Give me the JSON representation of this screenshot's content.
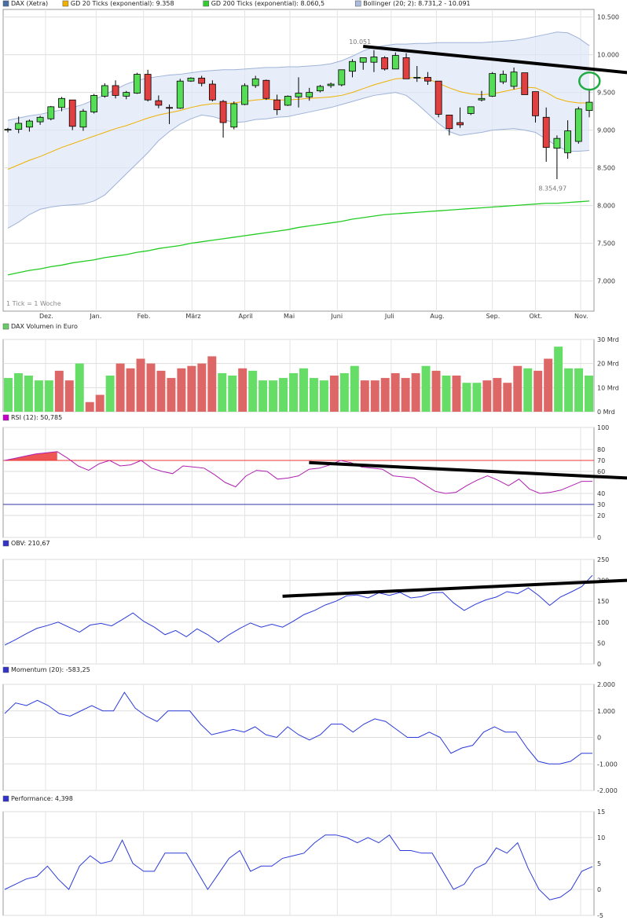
{
  "chart_data": [
    {
      "type": "candlestick",
      "legend": [
        {
          "label": "DAX (Xetra)",
          "color": "#4a6fa5"
        },
        {
          "label": "GD 20 Ticks (exponential): 9.358",
          "color": "#f0b000"
        },
        {
          "label": "GD 200 Ticks (exponential): 8.060,5",
          "color": "#33cc33"
        },
        {
          "label": "Bollinger (20; 2): 8.731,2 - 10.091",
          "color": "#aabbdd"
        }
      ],
      "ylim": [
        6600,
        10600
      ],
      "yticks": [
        {
          "v": 10500,
          "label": "10.500"
        },
        {
          "v": 10000,
          "label": "10.000"
        },
        {
          "v": 9500,
          "label": "9.500"
        },
        {
          "v": 9000,
          "label": "9.000"
        },
        {
          "v": 8500,
          "label": "8.500"
        },
        {
          "v": 8000,
          "label": "8.000"
        },
        {
          "v": 7500,
          "label": "7.500"
        },
        {
          "v": 7000,
          "label": "7.000"
        }
      ],
      "month_labels": [
        {
          "i": 3.5,
          "label": "Dez."
        },
        {
          "i": 8.2,
          "label": "Jan."
        },
        {
          "i": 12.6,
          "label": "Feb."
        },
        {
          "i": 17.1,
          "label": "März"
        },
        {
          "i": 22.0,
          "label": "April"
        },
        {
          "i": 26.2,
          "label": "Mai"
        },
        {
          "i": 30.6,
          "label": "Juni"
        },
        {
          "i": 35.6,
          "label": "Juli"
        },
        {
          "i": 39.8,
          "label": "Aug."
        },
        {
          "i": 45.0,
          "label": "Sep."
        },
        {
          "i": 49.0,
          "label": "Okt."
        },
        {
          "i": 53.2,
          "label": "Nov."
        }
      ],
      "tick_note": "1 Tick = 1 Woche",
      "annotations": [
        {
          "label": "10.051",
          "i": 33,
          "v": 10140
        },
        {
          "label": "8.354,97",
          "i": 50.6,
          "v": 8200
        }
      ],
      "candles": [
        [
          9000,
          9030,
          8970,
          9010
        ],
        [
          9010,
          9180,
          8960,
          9090
        ],
        [
          9040,
          9140,
          8980,
          9120
        ],
        [
          9110,
          9190,
          9070,
          9170
        ],
        [
          9150,
          9320,
          9130,
          9310
        ],
        [
          9300,
          9440,
          9250,
          9420
        ],
        [
          9400,
          9300,
          9000,
          9050
        ],
        [
          9040,
          9280,
          8990,
          9250
        ],
        [
          9240,
          9480,
          9220,
          9460
        ],
        [
          9450,
          9620,
          9430,
          9590
        ],
        [
          9590,
          9660,
          9420,
          9460
        ],
        [
          9450,
          9520,
          9410,
          9500
        ],
        [
          9490,
          9760,
          9480,
          9740
        ],
        [
          9740,
          9800,
          9380,
          9400
        ],
        [
          9390,
          9460,
          9290,
          9330
        ],
        [
          9300,
          9340,
          9080,
          9290
        ],
        [
          9290,
          9680,
          9280,
          9650
        ],
        [
          9650,
          9700,
          9640,
          9690
        ],
        [
          9690,
          9720,
          9580,
          9620
        ],
        [
          9610,
          9660,
          9380,
          9400
        ],
        [
          9380,
          9400,
          8900,
          9100
        ],
        [
          9040,
          9380,
          9010,
          9350
        ],
        [
          9340,
          9620,
          9330,
          9590
        ],
        [
          9590,
          9720,
          9560,
          9680
        ],
        [
          9660,
          9670,
          9400,
          9420
        ],
        [
          9400,
          9470,
          9200,
          9270
        ],
        [
          9330,
          9460,
          9320,
          9450
        ],
        [
          9440,
          9700,
          9300,
          9490
        ],
        [
          9440,
          9560,
          9390,
          9500
        ],
        [
          9520,
          9600,
          9500,
          9580
        ],
        [
          9590,
          9630,
          9560,
          9610
        ],
        [
          9600,
          9800,
          9580,
          9800
        ],
        [
          9780,
          9940,
          9700,
          9910
        ],
        [
          9900,
          9950,
          9800,
          9960
        ],
        [
          9900,
          10060,
          9770,
          9970
        ],
        [
          9960,
          9980,
          9790,
          9810
        ],
        [
          9810,
          10030,
          9810,
          9990
        ],
        [
          9960,
          10020,
          9680,
          9680
        ],
        [
          9700,
          9850,
          9640,
          9700
        ],
        [
          9700,
          9770,
          9600,
          9650
        ],
        [
          9650,
          9640,
          9170,
          9210
        ],
        [
          9200,
          9170,
          8930,
          9020
        ],
        [
          9100,
          9300,
          9030,
          9070
        ],
        [
          9220,
          9310,
          9200,
          9310
        ],
        [
          9400,
          9520,
          9380,
          9420
        ],
        [
          9450,
          9770,
          9440,
          9750
        ],
        [
          9640,
          9790,
          9610,
          9740
        ],
        [
          9580,
          9830,
          9540,
          9770
        ],
        [
          9760,
          9750,
          9490,
          9470
        ],
        [
          9510,
          9480,
          9100,
          9190
        ],
        [
          9170,
          9300,
          8580,
          8770
        ],
        [
          8760,
          8930,
          8350,
          8890
        ],
        [
          8700,
          9130,
          8620,
          8990
        ],
        [
          8850,
          9310,
          8820,
          9280
        ],
        [
          9260,
          9550,
          9170,
          9370
        ]
      ],
      "bollinger_upper": [
        9130,
        9160,
        9190,
        9210,
        9240,
        9270,
        9300,
        9340,
        9400,
        9470,
        9540,
        9610,
        9660,
        9690,
        9710,
        9730,
        9740,
        9760,
        9780,
        9790,
        9800,
        9800,
        9810,
        9820,
        9830,
        9830,
        9840,
        9840,
        9850,
        9860,
        9880,
        9920,
        9980,
        10050,
        10100,
        10120,
        10140,
        10140,
        10150,
        10150,
        10160,
        10160,
        10160,
        10160,
        10160,
        10170,
        10180,
        10190,
        10210,
        10240,
        10270,
        10300,
        10290,
        10220,
        10120
      ],
      "bollinger_lower": [
        7700,
        7780,
        7880,
        7950,
        7980,
        8000,
        8010,
        8020,
        8060,
        8140,
        8280,
        8420,
        8560,
        8700,
        8860,
        8980,
        9080,
        9150,
        9200,
        9180,
        9140,
        9100,
        9110,
        9140,
        9150,
        9170,
        9180,
        9210,
        9240,
        9270,
        9300,
        9340,
        9380,
        9420,
        9460,
        9480,
        9500,
        9460,
        9350,
        9220,
        9090,
        8980,
        8930,
        8950,
        8970,
        9000,
        9010,
        9020,
        9000,
        8970,
        8880,
        8790,
        8720,
        8720,
        8730
      ],
      "gd20": [
        8480,
        8540,
        8600,
        8650,
        8710,
        8770,
        8820,
        8870,
        8920,
        8970,
        9020,
        9060,
        9110,
        9160,
        9200,
        9230,
        9260,
        9300,
        9330,
        9350,
        9350,
        9360,
        9380,
        9400,
        9410,
        9400,
        9400,
        9410,
        9420,
        9430,
        9440,
        9460,
        9500,
        9550,
        9600,
        9640,
        9680,
        9690,
        9700,
        9680,
        9620,
        9560,
        9510,
        9480,
        9470,
        9480,
        9510,
        9540,
        9570,
        9560,
        9500,
        9420,
        9380,
        9360,
        9360
      ],
      "gd200": [
        7080,
        7110,
        7140,
        7160,
        7190,
        7210,
        7240,
        7260,
        7280,
        7310,
        7330,
        7350,
        7380,
        7400,
        7430,
        7450,
        7470,
        7500,
        7520,
        7540,
        7560,
        7580,
        7600,
        7620,
        7640,
        7660,
        7680,
        7710,
        7730,
        7750,
        7770,
        7790,
        7820,
        7840,
        7860,
        7880,
        7890,
        7900,
        7910,
        7920,
        7930,
        7940,
        7950,
        7960,
        7970,
        7980,
        7990,
        8000,
        8010,
        8020,
        8030,
        8030,
        8040,
        8050,
        8060
      ],
      "trendline": [
        {
          "i": 33,
          "v": 10110
        },
        {
          "i": 57,
          "v": 9770
        }
      ],
      "circle_marker": {
        "i": 53.8,
        "v": 9650
      }
    },
    {
      "type": "bar",
      "legend": [
        {
          "label": "DAX Volumen in Euro",
          "color": "#66cc66"
        }
      ],
      "ylim": [
        0,
        30
      ],
      "yticks": [
        {
          "v": 30,
          "label": "30 Mrd"
        },
        {
          "v": 20,
          "label": "20 Mrd"
        },
        {
          "v": 10,
          "label": "10 Mrd"
        },
        {
          "v": 0,
          "label": "0 Mrd"
        }
      ],
      "values": [
        14,
        16,
        15,
        13,
        13,
        17,
        13,
        20,
        4,
        7,
        15,
        20,
        18,
        22,
        20,
        17,
        14,
        18,
        19,
        20,
        23,
        16,
        15,
        18,
        17,
        13,
        13,
        14,
        16,
        18,
        14,
        13,
        15,
        16,
        19,
        13,
        13,
        14,
        16,
        14,
        16,
        19,
        17,
        15,
        15,
        12,
        12,
        13,
        14,
        12,
        19,
        18,
        17,
        22,
        27,
        18,
        18,
        15
      ]
    },
    {
      "type": "line",
      "legend": [
        {
          "label": "RSI (12): 50,785",
          "color": "#cc00cc"
        }
      ],
      "ylim": [
        0,
        100
      ],
      "yticks": [
        {
          "v": 100,
          "label": "100"
        },
        {
          "v": 80,
          "label": "80"
        },
        {
          "v": 70,
          "label": "70"
        },
        {
          "v": 60,
          "label": "60"
        },
        {
          "v": 40,
          "label": "40"
        },
        {
          "v": 30,
          "label": "30"
        },
        {
          "v": 20,
          "label": "20"
        },
        {
          "v": 0,
          "label": "0"
        }
      ],
      "values": [
        70,
        72,
        74,
        76,
        77,
        78,
        72,
        65,
        61,
        67,
        70,
        65,
        66,
        70,
        63,
        60,
        58,
        65,
        64,
        63,
        57,
        50,
        46,
        56,
        61,
        60,
        53,
        54,
        56,
        62,
        63,
        66,
        70,
        68,
        64,
        63,
        62,
        56,
        55,
        54,
        48,
        42,
        40,
        41,
        47,
        52,
        56,
        52,
        47,
        53,
        44,
        40,
        41,
        43,
        47,
        51,
        51
      ],
      "trendline": [
        {
          "i": 29,
          "v": 68
        },
        {
          "i": 57,
          "v": 54
        }
      ]
    },
    {
      "type": "line",
      "legend": [
        {
          "label": "OBV: 210,67",
          "color": "#3333cc"
        }
      ],
      "ylim": [
        0,
        250
      ],
      "yticks": [
        {
          "v": 250,
          "label": "250"
        },
        {
          "v": 200,
          "label": "200"
        },
        {
          "v": 150,
          "label": "150"
        },
        {
          "v": 100,
          "label": "100"
        },
        {
          "v": 50,
          "label": "50"
        },
        {
          "v": 0,
          "label": "0"
        }
      ],
      "values": [
        45,
        58,
        72,
        85,
        92,
        100,
        88,
        76,
        93,
        97,
        91,
        106,
        122,
        102,
        88,
        70,
        80,
        65,
        84,
        70,
        52,
        70,
        85,
        98,
        88,
        95,
        88,
        102,
        118,
        128,
        141,
        150,
        163,
        165,
        158,
        170,
        164,
        171,
        158,
        161,
        170,
        171,
        146,
        128,
        142,
        153,
        160,
        173,
        168,
        182,
        163,
        140,
        160,
        172,
        185,
        212
      ],
      "trendline": [
        {
          "i": 26,
          "v": 162
        },
        {
          "i": 57,
          "v": 200
        }
      ]
    },
    {
      "type": "line",
      "legend": [
        {
          "label": "Momentum (20): -583,25",
          "color": "#3333cc"
        }
      ],
      "ylim": [
        -2000,
        2000
      ],
      "yticks": [
        {
          "v": 2000,
          "label": "2.000"
        },
        {
          "v": 1000,
          "label": "1.000"
        },
        {
          "v": 0,
          "label": "0"
        },
        {
          "v": -1000,
          "label": "-1.000"
        },
        {
          "v": -2000,
          "label": "-2.000"
        }
      ],
      "values": [
        900,
        1300,
        1200,
        1400,
        1200,
        900,
        800,
        1000,
        1200,
        1000,
        1000,
        1700,
        1100,
        800,
        600,
        1000,
        1000,
        1000,
        500,
        100,
        200,
        300,
        200,
        400,
        100,
        0,
        400,
        100,
        -100,
        100,
        500,
        500,
        200,
        500,
        700,
        600,
        300,
        0,
        0,
        200,
        0,
        -600,
        -400,
        -300,
        200,
        400,
        200,
        200,
        -400,
        -900,
        -1000,
        -1000,
        -900,
        -600,
        -600
      ],
      "value_label": "-583,25"
    },
    {
      "type": "line",
      "legend": [
        {
          "label": "Performance: 4,398",
          "color": "#3333cc"
        }
      ],
      "ylim": [
        -5,
        15
      ],
      "yticks": [
        {
          "v": 15,
          "label": "15"
        },
        {
          "v": 10,
          "label": "10"
        },
        {
          "v": 5,
          "label": "5"
        },
        {
          "v": 0,
          "label": "0"
        },
        {
          "v": -5,
          "label": "-5"
        }
      ],
      "values": [
        0,
        1,
        2,
        2.5,
        4.5,
        2,
        0,
        4.5,
        6.5,
        5,
        5.5,
        9.5,
        5,
        3.5,
        3.5,
        7,
        7,
        7,
        3.5,
        0,
        3,
        6,
        7.5,
        3.5,
        4.5,
        4.5,
        6,
        6.5,
        7,
        9,
        10.5,
        10.5,
        10,
        9,
        10,
        9,
        10.5,
        7.5,
        7.5,
        7,
        7,
        3.5,
        0,
        1,
        4,
        5,
        8,
        7,
        9,
        4,
        0,
        -2,
        -1.5,
        0,
        3.5,
        4.4
      ]
    }
  ]
}
